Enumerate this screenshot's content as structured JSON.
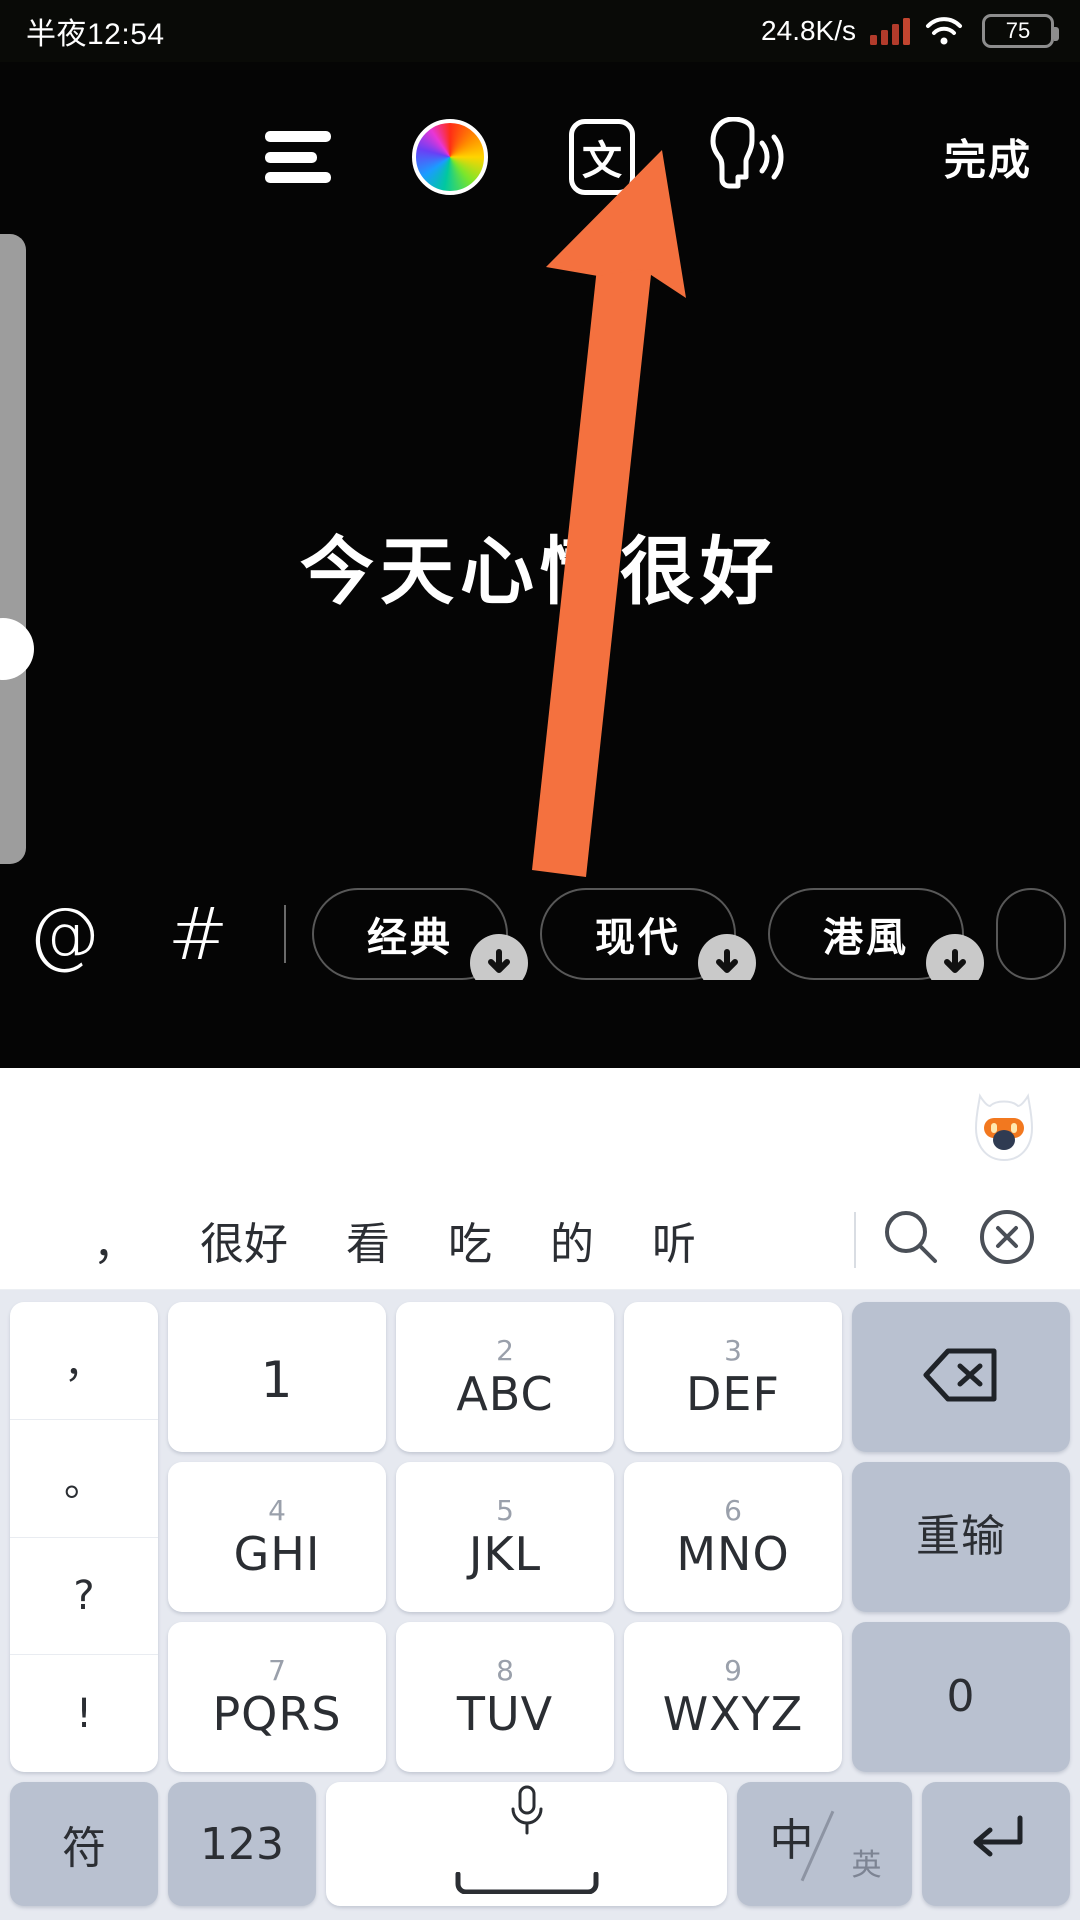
{
  "status_bar": {
    "time": "半夜12:54",
    "net_speed": "24.8K/s",
    "battery_level": "75",
    "signal_icon": "cellular-signal-icon",
    "wifi_icon": "wifi-icon",
    "signal_color": "#b23b2b"
  },
  "editor": {
    "toolbar": {
      "align_icon": "text-align-icon",
      "color_icon": "color-wheel-icon",
      "font_icon": "font-style-icon",
      "font_icon_label": "文",
      "speak_icon": "text-to-speech-icon",
      "done_label": "完成"
    },
    "canvas_text": "今天心情很好",
    "size_slider": {
      "name": "font-size-slider"
    },
    "annotation": {
      "type": "arrow",
      "color": "#f4713f",
      "points_to": "text-to-speech-icon"
    },
    "actions": {
      "mention_label": "@",
      "hashtag_label": "#"
    },
    "style_chips": [
      {
        "label": "经典",
        "download": true
      },
      {
        "label": "现代",
        "download": true
      },
      {
        "label": "港風",
        "download": true
      },
      {
        "label": "",
        "download": false,
        "partial": true
      }
    ]
  },
  "keyboard": {
    "mascot_icon": "fox-mascot-icon",
    "mascot_colors": {
      "band": "#f2781f",
      "nose": "#2f3b52"
    },
    "candidates": [
      "，",
      "很好",
      "看",
      "吃",
      "的",
      "听"
    ],
    "candidate_actions": {
      "search_icon": "search-icon",
      "close_icon": "close-circle-icon"
    },
    "punctuation_keys": [
      "，",
      "。",
      "?",
      "!"
    ],
    "keys": [
      {
        "num": "",
        "label": "1",
        "type": "normal"
      },
      {
        "num": "2",
        "label": "ABC",
        "type": "normal"
      },
      {
        "num": "3",
        "label": "DEF",
        "type": "normal"
      },
      {
        "num": "",
        "label": "",
        "type": "fn",
        "icon": "backspace-icon"
      },
      {
        "num": "4",
        "label": "GHI",
        "type": "normal"
      },
      {
        "num": "5",
        "label": "JKL",
        "type": "normal"
      },
      {
        "num": "6",
        "label": "MNO",
        "type": "normal"
      },
      {
        "num": "",
        "label": "重输",
        "type": "fn"
      },
      {
        "num": "7",
        "label": "PQRS",
        "type": "normal"
      },
      {
        "num": "8",
        "label": "TUV",
        "type": "normal"
      },
      {
        "num": "9",
        "label": "WXYZ",
        "type": "normal"
      },
      {
        "num": "",
        "label": "0",
        "type": "fn"
      }
    ],
    "bottom_row": {
      "symbol_label": "符",
      "numeric_label": "123",
      "space_icon": "microphone-icon",
      "lang_zh": "中",
      "lang_en": "英",
      "enter_icon": "enter-icon"
    }
  },
  "colors": {
    "canvas_bg": "#050505",
    "keyboard_bg": "#e6e9f0",
    "key_fn_bg": "#b9c1d0",
    "accent_arrow": "#f4713f"
  }
}
